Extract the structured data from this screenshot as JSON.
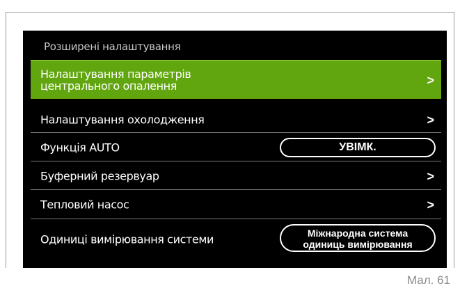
{
  "screen": {
    "title": "Розширені налаштування",
    "items": [
      {
        "label": "Налаштування параметрів\nцентрального опалення",
        "control": ">"
      },
      {
        "label": "Налаштування охолодження",
        "control": ">"
      },
      {
        "label": "Функція AUTO",
        "control": "УВІМК."
      },
      {
        "label": "Буферний резервуар",
        "control": ">"
      },
      {
        "label": "Тепловий насос",
        "control": ">"
      },
      {
        "label": "Одиниці вимірювання системи",
        "control": "Міжнародна система\nодиниць вимірювання"
      }
    ]
  },
  "caption": "Мал. 61",
  "colors": {
    "selected_row": "#61a60f",
    "screen_background": "#000000",
    "text": "#ffffff"
  }
}
